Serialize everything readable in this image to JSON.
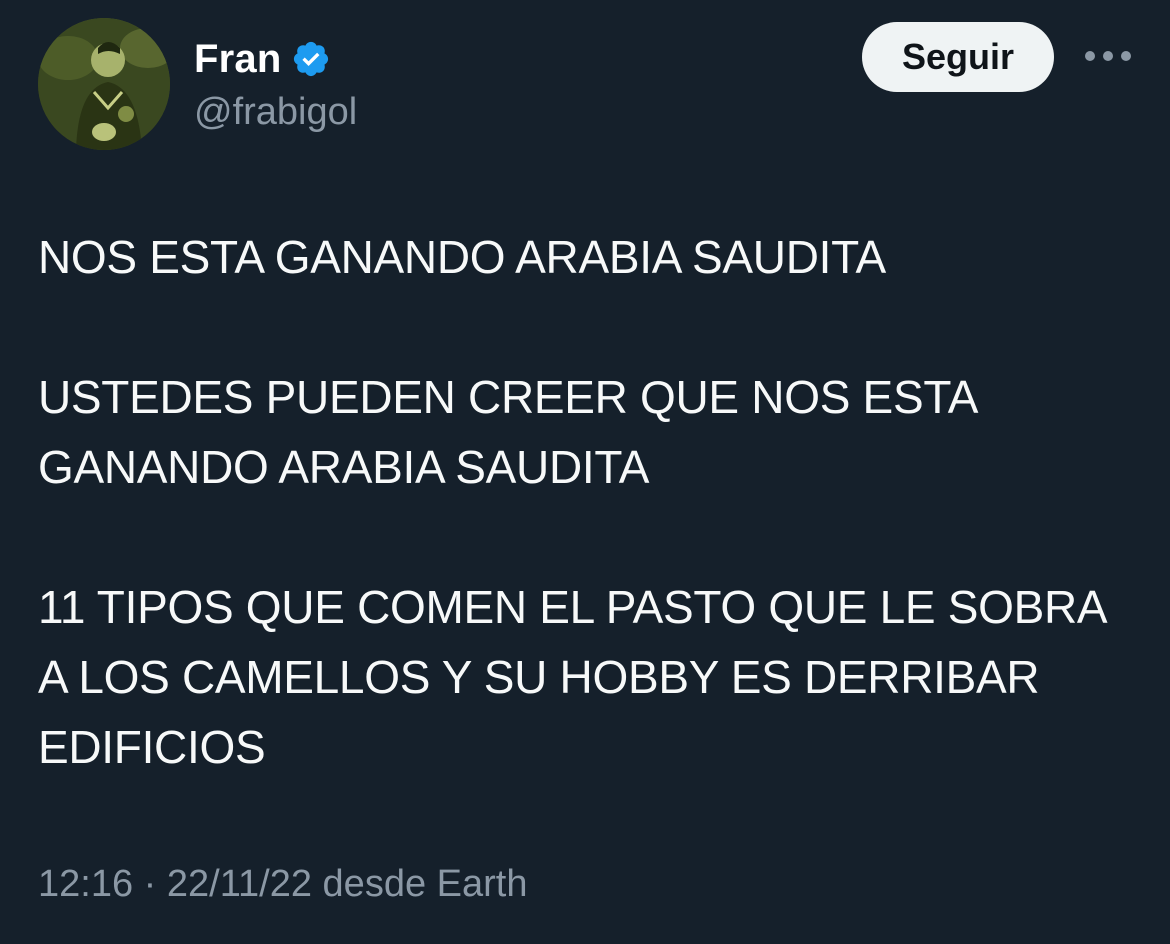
{
  "colors": {
    "background": "#15202b",
    "text_primary": "#f7f9f9",
    "text_secondary": "#8b98a5",
    "verified_badge": "#1d9bf0",
    "button_bg": "#eff3f4",
    "button_text": "#0f1419"
  },
  "author": {
    "display_name": "Fran",
    "handle": "@frabigol",
    "verified_icon": "verified-badge-icon",
    "avatar_icon": "avatar-photo"
  },
  "actions": {
    "follow_label": "Seguir",
    "more_icon": "more-options-icon"
  },
  "tweet": {
    "paragraphs": [
      "NOS ESTA GANANDO ARABIA SAUDITA",
      "USTEDES PUEDEN CREER QUE NOS ESTA GANANDO ARABIA SAUDITA",
      "11 TIPOS QUE COMEN EL PASTO QUE LE SOBRA A LOS CAMELLOS Y SU HOBBY ES DERRIBAR EDIFICIOS"
    ]
  },
  "meta": {
    "time": "12:16",
    "separator": "·",
    "date": "22/11/22",
    "source": "desde Earth"
  }
}
